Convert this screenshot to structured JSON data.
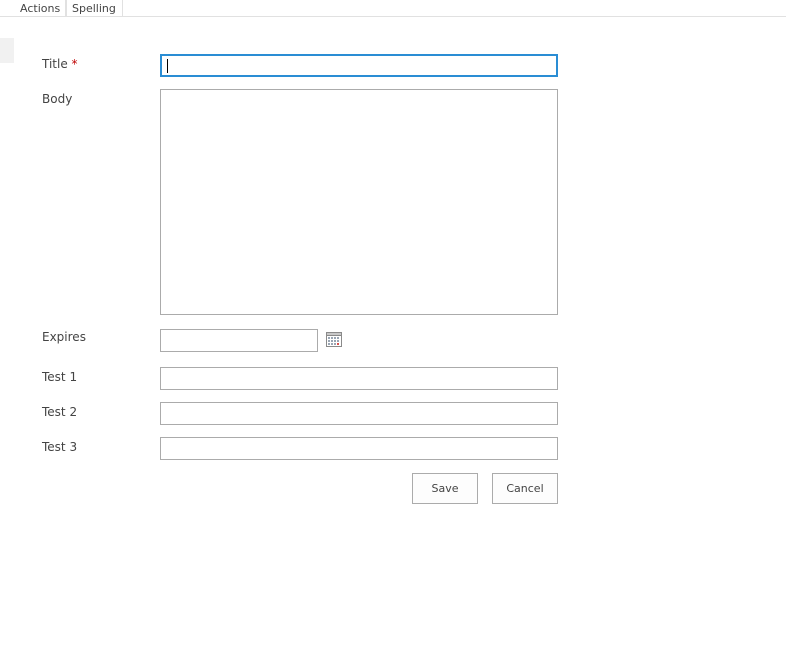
{
  "ribbon": {
    "groups": [
      {
        "label": "Actions"
      },
      {
        "label": "Spelling"
      }
    ]
  },
  "form": {
    "title": {
      "label": "Title",
      "required_mark": "*",
      "value": ""
    },
    "body": {
      "label": "Body",
      "value": ""
    },
    "expires": {
      "label": "Expires",
      "value": "",
      "icon": "calendar-icon"
    },
    "test1": {
      "label": "Test 1",
      "value": ""
    },
    "test2": {
      "label": "Test 2",
      "value": ""
    },
    "test3": {
      "label": "Test 3",
      "value": ""
    }
  },
  "buttons": {
    "save_label": "Save",
    "cancel_label": "Cancel"
  },
  "colors": {
    "focus_border": "#2a8dd4",
    "field_border": "#ababab",
    "required": "#bf0000"
  }
}
